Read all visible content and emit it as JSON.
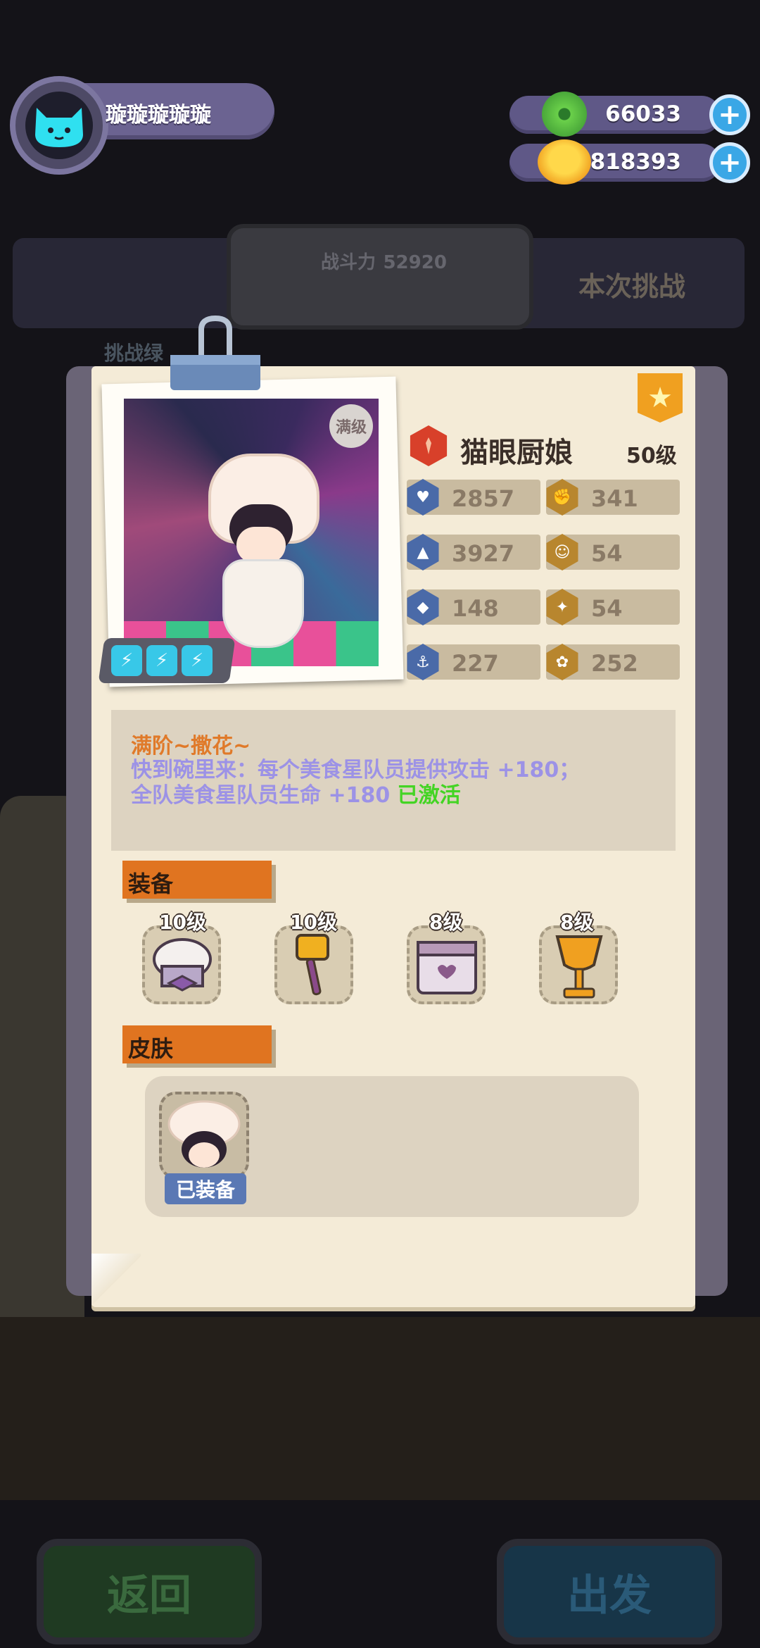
{
  "player": {
    "name": "璇璇璇璇璇",
    "avatar_icon": "cat-icon"
  },
  "currencies": [
    {
      "icon": "donut-coin-icon",
      "value": "66033"
    },
    {
      "icon": "planet-coin-icon",
      "value": "4818393"
    }
  ],
  "background": {
    "power_label": "战斗力",
    "power_value": "52920",
    "challenge_label": "本次挑战",
    "challenge_green_label": "挑战绿",
    "back_button": "返回",
    "go_button": "出发"
  },
  "card": {
    "maxed_badge": "满级",
    "name": "猫眼厨娘",
    "level": "50级",
    "energy_count": 3,
    "stats_left": [
      {
        "icon": "heart-shield-icon",
        "value": "2857"
      },
      {
        "icon": "sword-icon",
        "value": "3927"
      },
      {
        "icon": "shield-icon",
        "value": "148"
      },
      {
        "icon": "anchor-icon",
        "value": "227"
      }
    ],
    "stats_right": [
      {
        "icon": "fist-icon",
        "value": "341"
      },
      {
        "icon": "smile-icon",
        "value": "54"
      },
      {
        "icon": "muscle-icon",
        "value": "54"
      },
      {
        "icon": "brain-icon",
        "value": "252"
      }
    ],
    "skill": {
      "title": "满阶~撒花~",
      "desc": "快到碗里来：每个美食星队员提供攻击 +180；全队美食星队员生命 +180",
      "status": "已激活"
    },
    "equipment_label": "装备",
    "equipment": [
      {
        "name": "chef-hat-icon",
        "level": "10级"
      },
      {
        "name": "spatula-icon",
        "level": "10级"
      },
      {
        "name": "oven-icon",
        "level": "8级"
      },
      {
        "name": "trophy-cup-icon",
        "level": "8级"
      }
    ],
    "skin_label": "皮肤",
    "skin_equipped": "已装备"
  },
  "colors": {
    "accent_orange": "#e07420",
    "skill_purple": "#9c92e6",
    "activated_green": "#44d424",
    "card_bg": "#f4ebd7"
  }
}
